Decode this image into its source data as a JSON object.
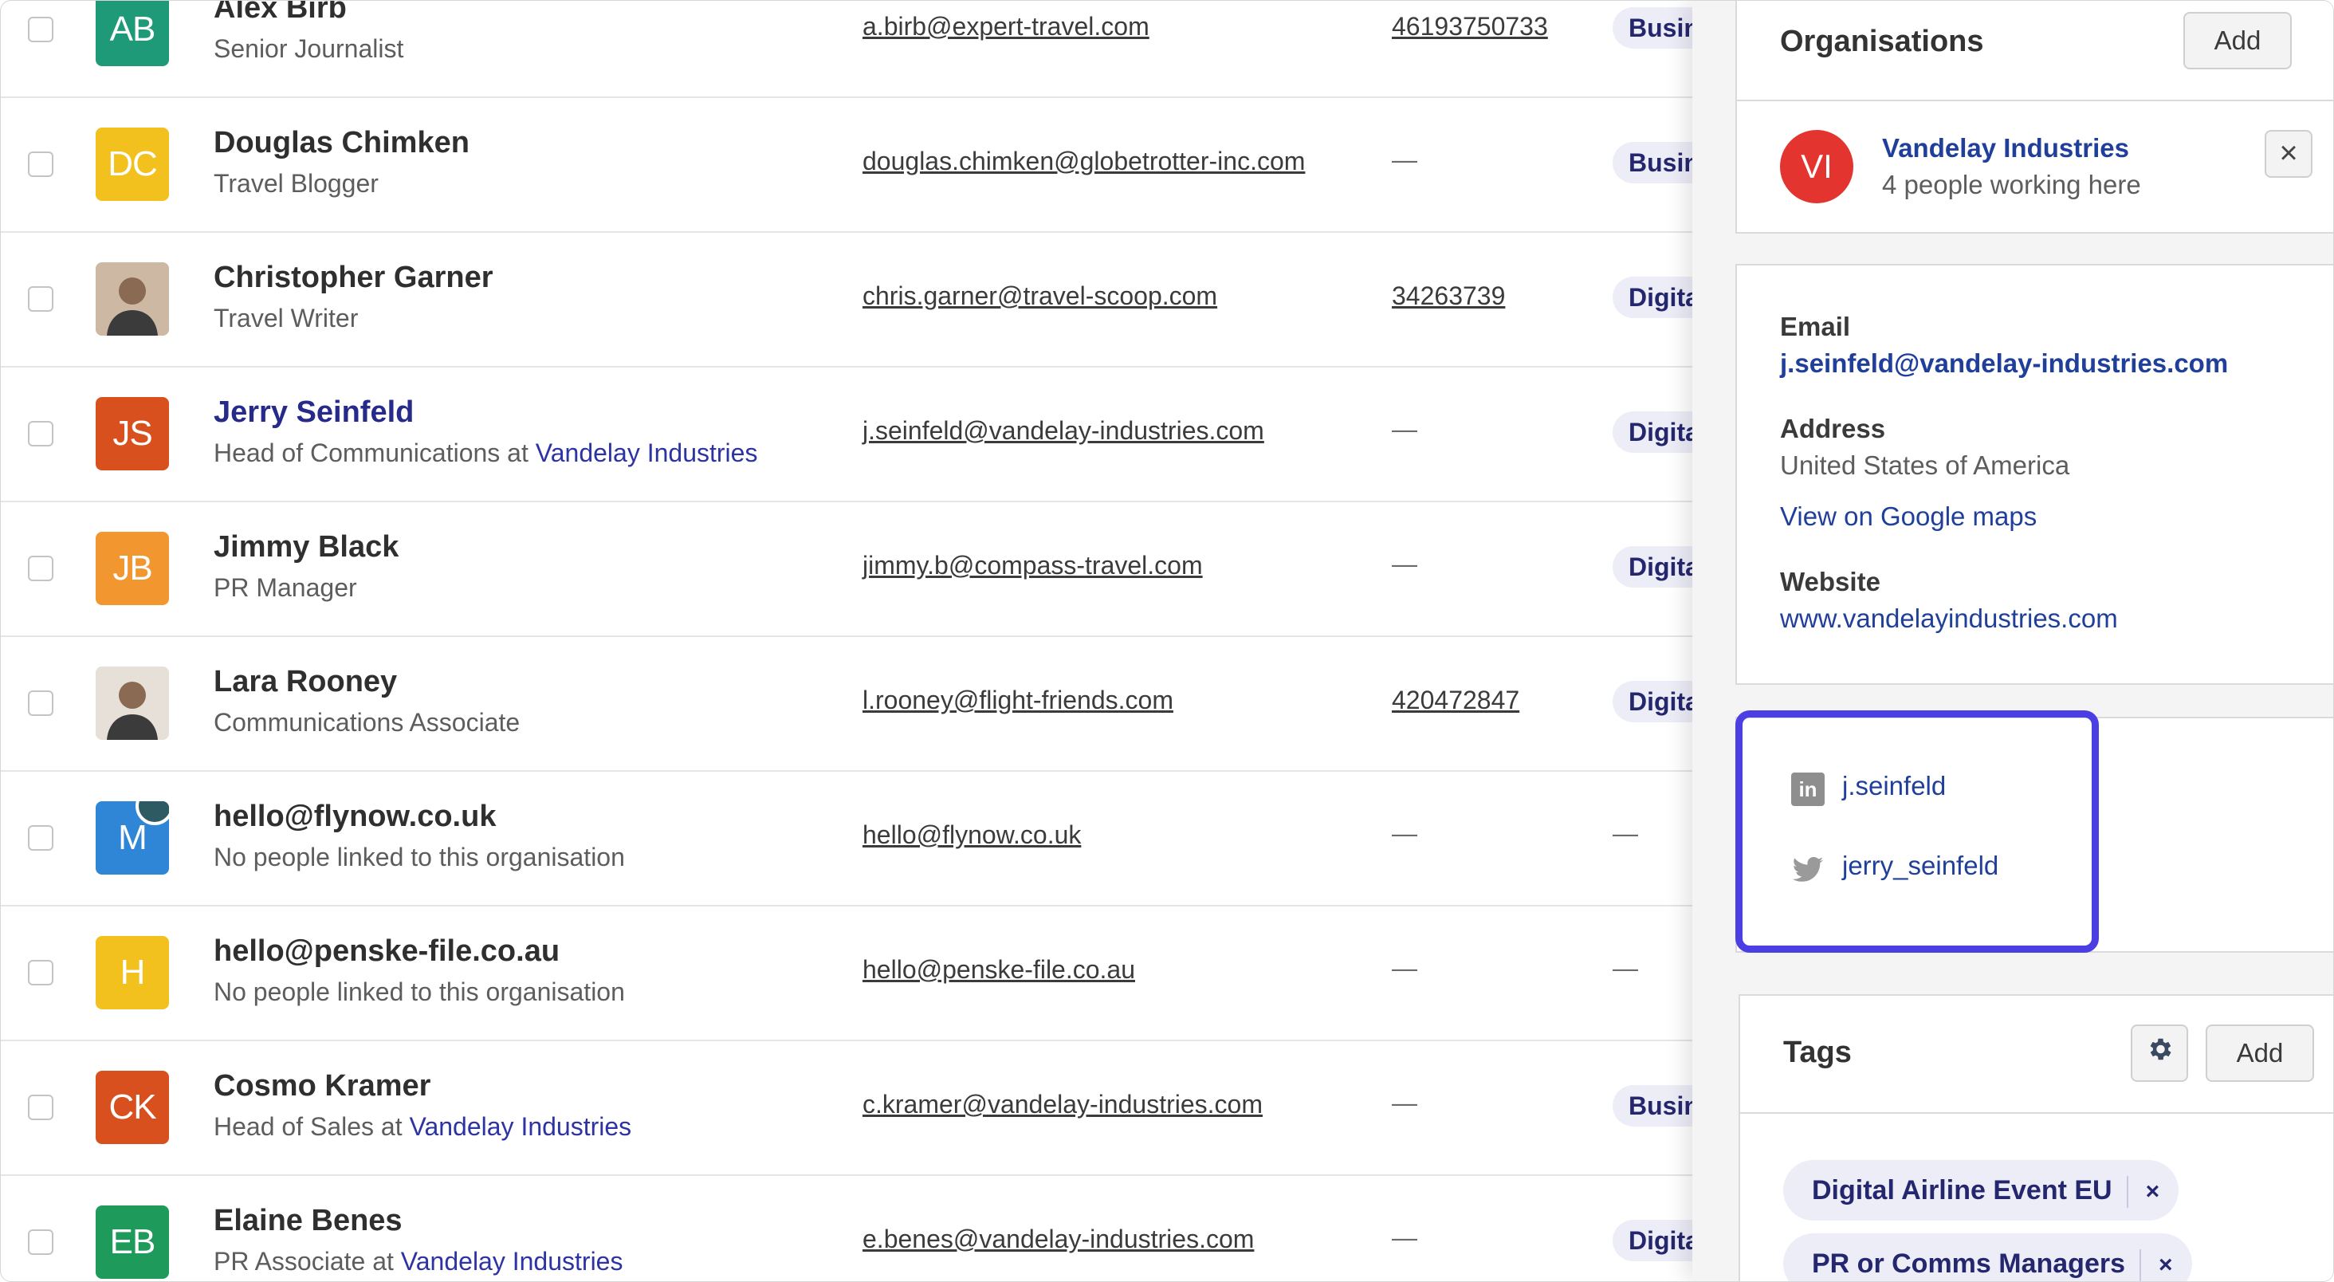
{
  "contacts": [
    {
      "initials": "AB",
      "avatar_color": "#1e9a78",
      "name": "Alex Birb",
      "role": "Senior Journalist",
      "org": "",
      "email": "a.birb@expert-travel.com",
      "phone": "46193750733",
      "tag": "Busin"
    },
    {
      "initials": "DC",
      "avatar_color": "#f2c11e",
      "name": "Douglas Chimken",
      "role": "Travel Blogger",
      "org": "",
      "email": "douglas.chimken@globetrotter-inc.com",
      "phone": "—",
      "tag": "Busin"
    },
    {
      "initials": "",
      "avatar_color": "#cdb9a3",
      "name": "Christopher Garner",
      "role": "Travel Writer",
      "org": "",
      "email": "chris.garner@travel-scoop.com",
      "phone": "34263739",
      "tag": "Digita"
    },
    {
      "initials": "JS",
      "avatar_color": "#d9501f",
      "name": "Jerry Seinfeld",
      "role": "Head of Communications at",
      "org": "Vandelay Industries",
      "email": "j.seinfeld@vandelay-industries.com",
      "phone": "—",
      "tag": "Digita"
    },
    {
      "initials": "JB",
      "avatar_color": "#f29630",
      "name": "Jimmy Black",
      "role": "PR Manager",
      "org": "",
      "email": "jimmy.b@compass-travel.com",
      "phone": "—",
      "tag": "Digita"
    },
    {
      "initials": "",
      "avatar_color": "#e6e0d8",
      "name": "Lara Rooney",
      "role": "Communications Associate",
      "org": "",
      "email": "l.rooney@flight-friends.com",
      "phone": "420472847",
      "tag": "Digita"
    },
    {
      "initials": "M",
      "avatar_color": "#2f86d6",
      "name": "hello@flynow.co.uk",
      "role": "No people linked to this organisation",
      "org": "",
      "email": "hello@flynow.co.uk",
      "phone": "—",
      "tag": "—"
    },
    {
      "initials": "H",
      "avatar_color": "#f2c11e",
      "name": "hello@penske-file.co.au",
      "role": "No people linked to this organisation",
      "org": "",
      "email": "hello@penske-file.co.au",
      "phone": "—",
      "tag": "—"
    },
    {
      "initials": "CK",
      "avatar_color": "#d9501f",
      "name": "Cosmo Kramer",
      "role": "Head of Sales at",
      "org": "Vandelay Industries",
      "email": "c.kramer@vandelay-industries.com",
      "phone": "—",
      "tag": "Busin"
    },
    {
      "initials": "EB",
      "avatar_color": "#1e9a5a",
      "name": "Elaine Benes",
      "role": "PR Associate at",
      "org": "Vandelay Industries",
      "email": "e.benes@vandelay-industries.com",
      "phone": "—",
      "tag": "Digita"
    }
  ],
  "panel": {
    "organisations": {
      "title": "Organisations",
      "add_label": "Add",
      "org_initials": "VI",
      "org_color": "#e3342f",
      "org_name": "Vandelay Industries",
      "org_subtitle": "4 people working here",
      "remove_glyph": "×"
    },
    "details": {
      "email_label": "Email",
      "email_value": "j.seinfeld@vandelay-industries.com",
      "address_label": "Address",
      "address_value": "United States of America",
      "maps_link": "View on Google maps",
      "website_label": "Website",
      "website_value": "www.vandelayindustries.com"
    },
    "social": {
      "linkedin": "j.seinfeld",
      "twitter": "jerry_seinfeld",
      "highlight_color": "#4b3fe3"
    },
    "tags": {
      "title": "Tags",
      "add_label": "Add",
      "items": [
        {
          "label": "Digital Airline Event EU",
          "remove": "×"
        },
        {
          "label": "PR or Comms Managers",
          "remove": "×"
        }
      ]
    }
  }
}
